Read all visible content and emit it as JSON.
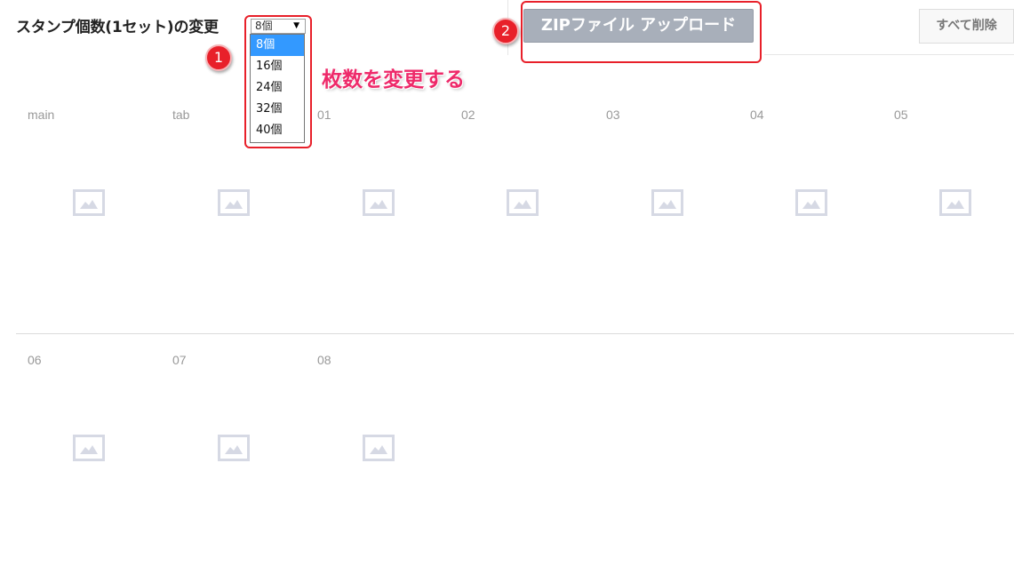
{
  "header": {
    "title": "スタンプ個数(1セット)の変更"
  },
  "count_select": {
    "value": "8個",
    "arrow": "▼",
    "options": [
      "8個",
      "16個",
      "24個",
      "32個",
      "40個"
    ],
    "selected_index": 0
  },
  "annotations": {
    "badge_1": "1",
    "badge_2": "2",
    "callout": "枚数を変更する",
    "color": "#e8202a",
    "callout_color": "#ee2a6a"
  },
  "toolbar": {
    "zip_upload_label": "ZIPファイル アップロード",
    "delete_all_label": "すべて削除"
  },
  "grid": {
    "row1": [
      "main",
      "tab",
      "01",
      "02",
      "03",
      "04",
      "05"
    ],
    "row2": [
      "06",
      "07",
      "08"
    ],
    "placeholder_icon": "image-placeholder-icon"
  },
  "colors": {
    "zip_button_bg": "#a8afba",
    "selected_option_bg": "#3399ff",
    "placeholder_border": "#d6d9e4"
  }
}
